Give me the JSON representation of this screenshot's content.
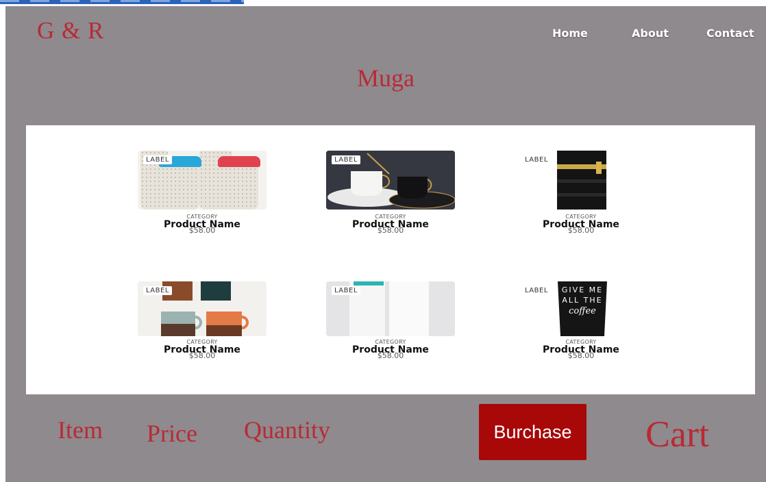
{
  "header": {
    "logo": "G & R",
    "nav": [
      {
        "label": "Home"
      },
      {
        "label": "About"
      },
      {
        "label": "Contact"
      }
    ]
  },
  "page_title": "Muga",
  "products": [
    {
      "label": "LABEL",
      "category": "CATEGORY",
      "name": "Product Name",
      "price": "$58.00",
      "image": "speckled-cups-with-lids"
    },
    {
      "label": "LABEL",
      "category": "CATEGORY",
      "name": "Product Name",
      "price": "$58.00",
      "image": "black-and-white-mugs-on-plates"
    },
    {
      "label": "LABEL",
      "category": "CATEGORY",
      "name": "Product Name",
      "price": "$58.00",
      "image": "black-striped-tumbler"
    },
    {
      "label": "LABEL",
      "category": "CATEGORY",
      "name": "Product Name",
      "price": "$58.00",
      "image": "glazed-ceramic-mugs"
    },
    {
      "label": "LABEL",
      "category": "CATEGORY",
      "name": "Product Name",
      "price": "$58.00",
      "image": "white-travel-bottles"
    },
    {
      "label": "LABEL",
      "category": "CATEGORY",
      "name": "Product Name",
      "price": "$58.00",
      "image": "black-cup-give-me-coffee"
    }
  ],
  "coffee_cup_text": "GIVE ME ALL THE coffee",
  "footer": {
    "item": "Item",
    "price": "Price",
    "quantity": "Quantity",
    "purchase_button": "Burchase",
    "cart": "Cart"
  },
  "colors": {
    "background": "#8f8a8e",
    "accent_text": "#b82a35",
    "button": "#a80808",
    "panel": "#ffffff"
  }
}
